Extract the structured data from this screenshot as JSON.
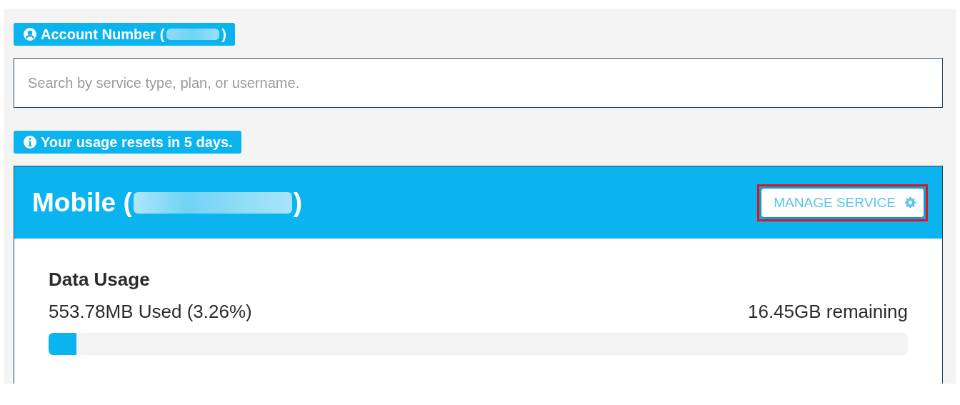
{
  "account_badge": {
    "label": "Account Number (",
    "closing": ")",
    "redacted": true
  },
  "search": {
    "placeholder": "Search by service type, plan, or username."
  },
  "notice": {
    "text": "Your usage resets in 5 days."
  },
  "service": {
    "title": "Mobile (",
    "closing": ")",
    "redacted": true,
    "manage_button": {
      "label": "MANAGE SERVICE",
      "highlighted": true
    },
    "usage": {
      "heading": "Data Usage",
      "used": "553.78MB Used (3.26%)",
      "remaining": "16.45GB remaining",
      "level": 0.0326
    }
  }
}
